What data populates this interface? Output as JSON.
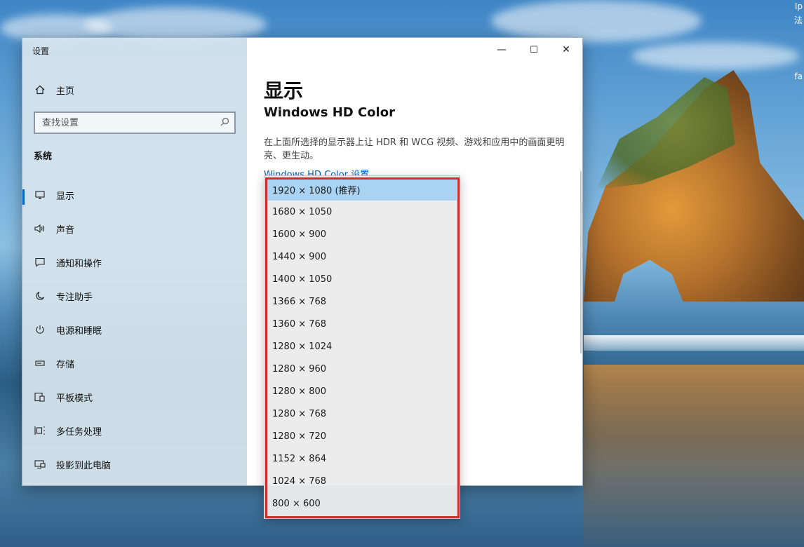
{
  "desktop": {
    "corner_texts": [
      "Ip",
      "法",
      "fa"
    ]
  },
  "window": {
    "title": "设置",
    "controls": {
      "minimize": "—",
      "maximize": "☐",
      "close": "✕"
    }
  },
  "nav": {
    "home_label": "主页",
    "search_placeholder": "查找设置",
    "section_label": "系统",
    "items": [
      {
        "label": "显示",
        "icon": "monitor-icon"
      },
      {
        "label": "声音",
        "icon": "speaker-icon"
      },
      {
        "label": "通知和操作",
        "icon": "notification-icon"
      },
      {
        "label": "专注助手",
        "icon": "moon-icon"
      },
      {
        "label": "电源和睡眠",
        "icon": "power-icon"
      },
      {
        "label": "存储",
        "icon": "storage-icon"
      },
      {
        "label": "平板模式",
        "icon": "tablet-icon"
      },
      {
        "label": "多任务处理",
        "icon": "multitask-icon"
      },
      {
        "label": "投影到此电脑",
        "icon": "project-icon"
      }
    ]
  },
  "main": {
    "page_title": "显示",
    "section_title": "Windows HD Color",
    "description": "在上面所选择的显示器上让 HDR 和 WCG 视频、游戏和应用中的画面更明亮、更生动。",
    "link": "Windows HD Color 设置"
  },
  "resolution_dropdown": {
    "selected_index": 0,
    "options": [
      "1920 × 1080 (推荐)",
      "1680 × 1050",
      "1600 × 900",
      "1440 × 900",
      "1400 × 1050",
      "1366 × 768",
      "1360 × 768",
      "1280 × 1024",
      "1280 × 960",
      "1280 × 800",
      "1280 × 768",
      "1280 × 720",
      "1152 × 864",
      "1024 × 768",
      "800 × 600"
    ]
  },
  "colors": {
    "accent": "#0067c0",
    "selection": "#a9d3f2",
    "annotation": "#d42b2b"
  }
}
